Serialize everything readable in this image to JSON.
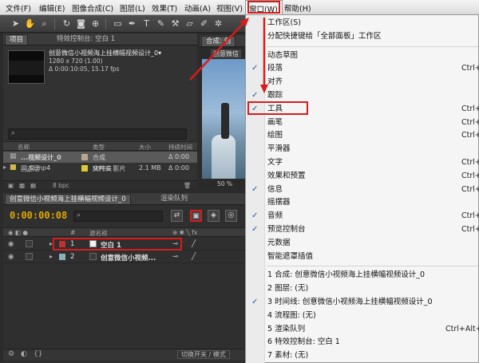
{
  "menubar": {
    "items": [
      "文件(F)",
      "编辑(E)",
      "图像合成(C)",
      "图层(L)",
      "效果(T)",
      "动画(A)",
      "视图(V)",
      "窗口(W)",
      "帮助(H)"
    ]
  },
  "project_panel": {
    "tabs": [
      "项目",
      "特效控制台: 空白 1"
    ],
    "comp_name": "创意微信小视频海上挂横幅视频设计_0▾",
    "resolution": "1280 x 720 (1.00)",
    "duration": "Δ 0:00:10:05, 15.17 fps",
    "columns": [
      "名称",
      "类型",
      "大小",
      "持续时间"
    ],
    "rows": [
      {
        "name": "...视频设计_0",
        "type": "合成",
        "size": "",
        "duration": "Δ 0:00",
        "swatch": "#b4a990"
      },
      {
        "name": "..._0.mp4",
        "type": "MPEG 影片",
        "size": "2.1 MB",
        "duration": "Δ 0:00",
        "swatch": "#8a9ca0"
      },
      {
        "name": "固态层",
        "type": "文件夹",
        "size": "",
        "duration": "",
        "swatch": "#dccb30"
      }
    ],
    "footer_bpc": "8 bpc"
  },
  "comp_panel": {
    "tab": "合成: 创",
    "subtab": "创意微信",
    "zoom": "50 %"
  },
  "timeline": {
    "tabs": [
      "创意微信小视频海上挂横幅视频设计_0",
      "渲染队列"
    ],
    "timecode": "0:00:00:08",
    "search_placeholder": "",
    "columns": [
      "#",
      "源名称"
    ],
    "layers": [
      {
        "num": "1",
        "name": "空白 1",
        "swatch": "#c03030"
      },
      {
        "num": "2",
        "name": "创意微信小视频...",
        "swatch": "#8ab0b8"
      }
    ],
    "footer_button": "切换开关 / 模式"
  },
  "window_menu": {
    "items": [
      {
        "label": "工作区(S)",
        "checked": false,
        "shortcut": ""
      },
      {
        "label": "分配快捷键给「全部面板」工作区",
        "checked": false,
        "shortcut": ""
      },
      {
        "sep": true
      },
      {
        "label": "动态草图",
        "checked": false,
        "shortcut": ""
      },
      {
        "label": "段落",
        "checked": true,
        "shortcut": "Ctrl+"
      },
      {
        "label": "对齐",
        "checked": false,
        "shortcut": ""
      },
      {
        "label": "跟踪",
        "checked": true,
        "shortcut": ""
      },
      {
        "label": "工具",
        "checked": true,
        "shortcut": "Ctrl+"
      },
      {
        "label": "画笔",
        "checked": false,
        "shortcut": "Ctrl+"
      },
      {
        "label": "绘图",
        "checked": false,
        "shortcut": "Ctrl+"
      },
      {
        "label": "平滑器",
        "checked": false,
        "shortcut": ""
      },
      {
        "label": "文字",
        "checked": false,
        "shortcut": "Ctrl+"
      },
      {
        "label": "效果和预置",
        "checked": false,
        "shortcut": "Ctrl+"
      },
      {
        "label": "信息",
        "checked": true,
        "shortcut": "Ctrl+"
      },
      {
        "label": "摇摆器",
        "checked": false,
        "shortcut": ""
      },
      {
        "label": "音频",
        "checked": true,
        "shortcut": "Ctrl+"
      },
      {
        "label": "预览控制台",
        "checked": true,
        "shortcut": "Ctrl+"
      },
      {
        "label": "元数据",
        "checked": false,
        "shortcut": ""
      },
      {
        "label": "智能遮罩插值",
        "checked": false,
        "shortcut": ""
      },
      {
        "sep": true
      },
      {
        "label": "1 合成: 创意微信小视频海上挂横幅视频设计_0",
        "checked": false,
        "shortcut": ""
      },
      {
        "label": "2 图层: (无)",
        "checked": false,
        "shortcut": ""
      },
      {
        "label": "3 时间线: 创意微信小视频海上挂横幅视频设计_0",
        "checked": true,
        "shortcut": ""
      },
      {
        "label": "4 流程图: (无)",
        "checked": false,
        "shortcut": ""
      },
      {
        "label": "5 渲染队列",
        "checked": false,
        "shortcut": "Ctrl+Alt+"
      },
      {
        "label": "6 特效控制台: 空白 1",
        "checked": false,
        "shortcut": ""
      },
      {
        "label": "7 素材: (无)",
        "checked": false,
        "shortcut": ""
      }
    ]
  },
  "colors": {
    "highlight": "#d81c1c",
    "timecode": "#e2a800",
    "check": "#1c56b0"
  }
}
